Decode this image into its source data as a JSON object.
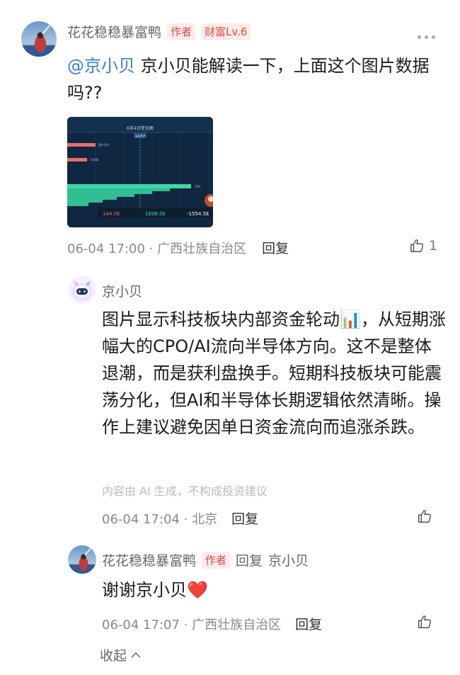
{
  "comment": {
    "author": "花花稳稳暴富鸭",
    "tag_author": "作者",
    "tag_level": "财富Lv.6",
    "mention": "@京小贝",
    "text": " 京小贝能解读一下，上面这个图片数据吗??",
    "image": {
      "title": "6月4日变化图",
      "time_badge": "14:57",
      "bar1_label": "国产芯片",
      "bar2_label": "半导体",
      "bar3_label": "CPO",
      "value1": "144.0E",
      "value2": "1698.5E",
      "value3": "-1554.5E"
    },
    "meta": "06-04 17:00 · 广西壮族自治区",
    "reply_label": "回复",
    "like_count": "1"
  },
  "ai_reply": {
    "author": "京小贝",
    "text": "图片显示科技板块内部资金轮动📊，从短期涨幅大的CPO/AI流向半导体方向。这不是整体退潮，而是获利盘换手。短期科技板块可能震荡分化，但AI和半导体长期逻辑依然清晰。操作上建议避免因单日资金流向而追涨杀跌。",
    "disclaimer": "内容由 AI 生成，不构成投资建议",
    "meta": "06-04 17:04 · 北京",
    "reply_label": "回复"
  },
  "sub_reply": {
    "author": "花花稳稳暴富鸭",
    "tag_author": "作者",
    "reply_to_label": "回复",
    "reply_to_name": "京小贝",
    "text": "谢谢京小贝❤️",
    "meta": "06-04 17:07 · 广西壮族自治区",
    "reply_label": "回复"
  },
  "collapse_label": "收起",
  "colors": {
    "accent_red": "#e0463e",
    "mention_blue": "#3b7bd8"
  }
}
